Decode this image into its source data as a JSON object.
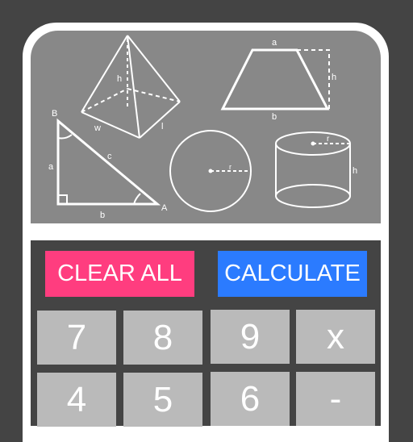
{
  "screen": {
    "diagram_labels": {
      "pyramid": {
        "height": "h",
        "width": "w",
        "length": "l"
      },
      "trapezoid": {
        "top": "a",
        "bottom": "b",
        "height": "h"
      },
      "triangle": {
        "vertex_b": "B",
        "vertex_a": "A",
        "side_a": "a",
        "side_b": "b",
        "side_c": "c"
      },
      "circle": {
        "radius": "r"
      },
      "cylinder": {
        "radius": "r",
        "height": "h"
      }
    }
  },
  "actions": {
    "clear_label": "CLEAR ALL",
    "calculate_label": "CALCULATE"
  },
  "keys": [
    "7",
    "8",
    "9",
    "x",
    "4",
    "5",
    "6",
    "-"
  ],
  "colors": {
    "clear": "#ff3d7f",
    "calculate": "#2b7bff",
    "key": "#bababa",
    "background": "#444444",
    "screen": "#888888"
  }
}
